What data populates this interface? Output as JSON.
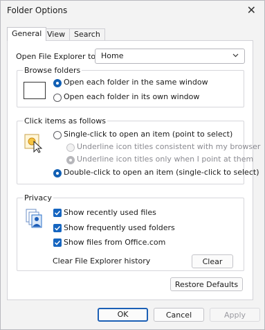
{
  "window": {
    "title": "Folder Options",
    "close_glyph": "✕"
  },
  "tabs": [
    "General",
    "View",
    "Search"
  ],
  "general": {
    "open_label": "Open File Explorer to:",
    "open_value": "Home",
    "browse": {
      "title": "Browse folders",
      "same_window": "Open each folder in the same window",
      "own_window": "Open each folder in its own window",
      "selected": "same_window"
    },
    "click": {
      "title": "Click items as follows",
      "single": "Single-click to open an item (point to select)",
      "underline_browser": "Underline icon titles consistent with my browser",
      "underline_point": "Underline icon titles only when I point at them",
      "double": "Double-click to open an item (single-click to select)",
      "selected": "double"
    },
    "privacy": {
      "title": "Privacy",
      "recent_files": "Show recently used files",
      "frequent_folders": "Show frequently used folders",
      "office_files": "Show files from Office.com",
      "clear_history_label": "Clear File Explorer history",
      "clear_button": "Clear"
    },
    "restore_defaults": "Restore Defaults"
  },
  "footer": {
    "ok": "OK",
    "cancel": "Cancel",
    "apply": "Apply"
  },
  "colors": {
    "accent": "#1565c0",
    "dialog_bg": "#f3f3f3",
    "panel_bg": "#ffffff"
  }
}
